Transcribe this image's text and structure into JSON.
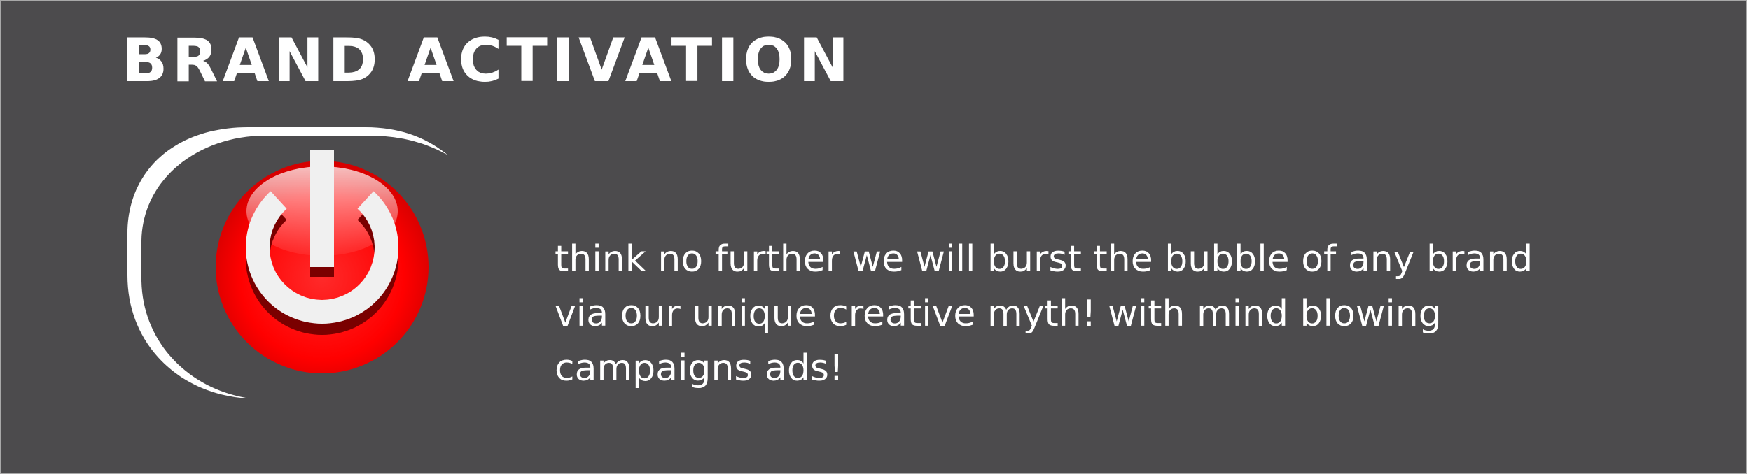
{
  "banner": {
    "title": "BRAND ACTIVATION",
    "tagline": "think no further we will burst the bubble of any brand via our unique creative myth! with mind blowing campaigns ads!",
    "icon": "power-button-icon"
  },
  "colors": {
    "background": "#4c4b4d",
    "frame": "#a8a8a8",
    "text": "#ffffff",
    "accent_red": "#ff0000",
    "symbol_white": "#f2f2f2"
  }
}
